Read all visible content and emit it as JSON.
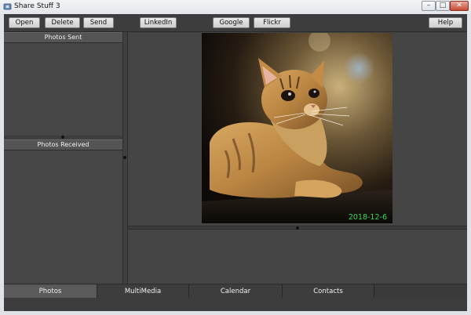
{
  "window": {
    "title": "Share Stuff 3",
    "min_glyph": "–",
    "max_glyph": "□",
    "close_glyph": "✕"
  },
  "toolbar": {
    "open": "Open",
    "delete": "Delete",
    "send": "Send",
    "linkedin": "LinkedIn",
    "google": "Google",
    "flickr": "Flickr",
    "help": "Help"
  },
  "left_panel": {
    "sent_header": "Photos Sent",
    "received_header": "Photos Received"
  },
  "preview": {
    "date": "2018-12-6",
    "date_color": "#3ddc54"
  },
  "tabs": [
    {
      "label": "Photos",
      "active": true
    },
    {
      "label": "MultiMedia",
      "active": false
    },
    {
      "label": "Calendar",
      "active": false
    },
    {
      "label": "Contacts",
      "active": false
    }
  ]
}
